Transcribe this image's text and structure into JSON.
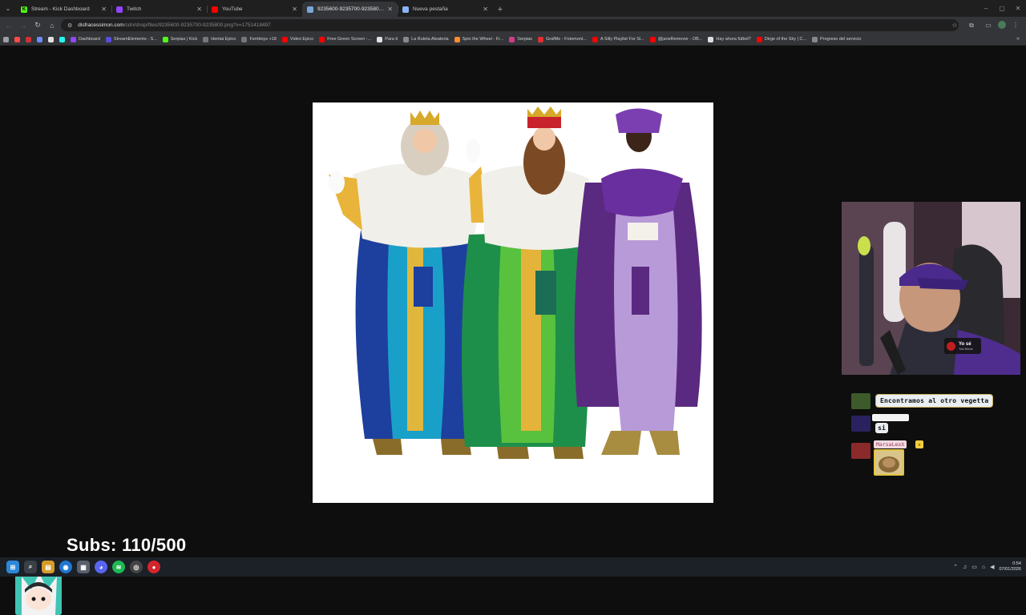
{
  "browser": {
    "tabs": [
      {
        "title": "Stream - Kick Dashboard",
        "icon": "kick-icon",
        "color": "#53fc18",
        "glyph": "K",
        "active": false
      },
      {
        "title": "Twitch",
        "icon": "twitch-icon",
        "color": "#9146ff",
        "glyph": "",
        "active": false
      },
      {
        "title": "YouTube",
        "icon": "youtube-icon",
        "color": "#ff0000",
        "glyph": "",
        "active": false
      },
      {
        "title": "9235600-9235700-9235800.png",
        "icon": "image-icon",
        "color": "#7aa7d8",
        "glyph": "",
        "active": true
      },
      {
        "title": "Nueva pestaña",
        "icon": "chrome-icon",
        "color": "#8ab4f8",
        "glyph": "",
        "active": false
      }
    ],
    "url_host": "disfracessimon.com",
    "url_path": "/cdn/shop/files/9235600-9235700-9235800.png?v=1751418497",
    "bookmarks": [
      {
        "label": "",
        "color": "#ff4a4a"
      },
      {
        "label": "",
        "color": "#c33"
      },
      {
        "label": "",
        "color": "#6b8cff"
      },
      {
        "label": "",
        "color": "#e0e0e0"
      },
      {
        "label": "",
        "color": "#25f4ee"
      },
      {
        "label": "Dashboard",
        "color": "#9146ff"
      },
      {
        "label": "StreamElements - S...",
        "color": "#5b4ddb"
      },
      {
        "label": "Serpias | Kick",
        "color": "#53fc18"
      },
      {
        "label": "Hentai Epico",
        "color": "#777"
      },
      {
        "label": "Femboys +18",
        "color": "#777"
      },
      {
        "label": "Video Epico",
        "color": "#ff0000"
      },
      {
        "label": "Free Green Screen -...",
        "color": "#ff0000"
      },
      {
        "label": "Para ti",
        "color": "#e0e0e0"
      },
      {
        "label": "La Ruleta Aleatoria",
        "color": "#888"
      },
      {
        "label": "Spin the Wheel - Fr...",
        "color": "#ff8c2a"
      },
      {
        "label": "Serpias",
        "color": "#d43b8a"
      },
      {
        "label": "GrafMe - Fotomont...",
        "color": "#e03030"
      },
      {
        "label": "A Silly Playlist For Si...",
        "color": "#ff0000"
      },
      {
        "label": "@janeRemover - OB...",
        "color": "#ff0000"
      },
      {
        "label": "Hay ahora fútbol?",
        "color": "#dddddd"
      },
      {
        "label": "Dirge of the Sky | C...",
        "color": "#ff0000"
      },
      {
        "label": "Progreso del servicio",
        "color": "#888"
      }
    ]
  },
  "overlay": {
    "ticker_title": "Yo sé",
    "ticker_artist": "Yan Block",
    "chat": {
      "message1": "Encontramos al otro vegetta",
      "message2": "si",
      "username3": "MarsaLexX"
    },
    "subs_goal": "Subs: 110/500"
  },
  "taskbar": {
    "time": "0:54",
    "date": "07/01/2026"
  }
}
